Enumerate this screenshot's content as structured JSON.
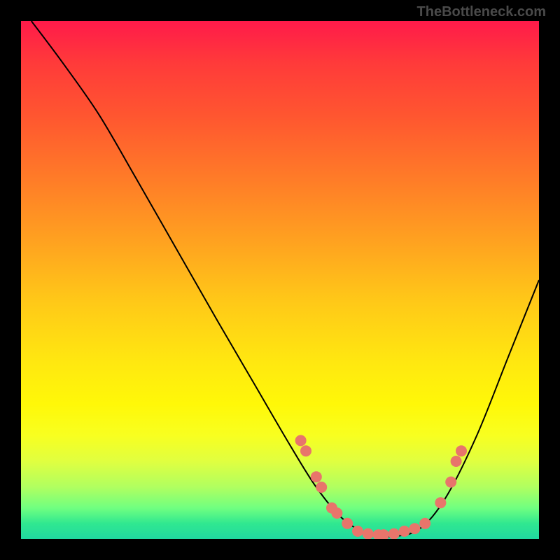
{
  "watermark": "TheBottleneck.com",
  "chart_data": {
    "type": "line",
    "title": "",
    "xlabel": "",
    "ylabel": "",
    "xlim": [
      0,
      100
    ],
    "ylim": [
      0,
      100
    ],
    "curve_points": [
      {
        "x": 2,
        "y": 100
      },
      {
        "x": 8,
        "y": 92
      },
      {
        "x": 15,
        "y": 82
      },
      {
        "x": 22,
        "y": 70
      },
      {
        "x": 30,
        "y": 56
      },
      {
        "x": 38,
        "y": 42
      },
      {
        "x": 45,
        "y": 30
      },
      {
        "x": 52,
        "y": 18
      },
      {
        "x": 57,
        "y": 10
      },
      {
        "x": 62,
        "y": 4
      },
      {
        "x": 67,
        "y": 1
      },
      {
        "x": 72,
        "y": 0.5
      },
      {
        "x": 77,
        "y": 2
      },
      {
        "x": 82,
        "y": 8
      },
      {
        "x": 88,
        "y": 20
      },
      {
        "x": 94,
        "y": 35
      },
      {
        "x": 100,
        "y": 50
      }
    ],
    "scatter_points": [
      {
        "x": 54,
        "y": 19
      },
      {
        "x": 55,
        "y": 17
      },
      {
        "x": 57,
        "y": 12
      },
      {
        "x": 58,
        "y": 10
      },
      {
        "x": 60,
        "y": 6
      },
      {
        "x": 61,
        "y": 5
      },
      {
        "x": 63,
        "y": 3
      },
      {
        "x": 65,
        "y": 1.5
      },
      {
        "x": 67,
        "y": 1
      },
      {
        "x": 69,
        "y": 0.8
      },
      {
        "x": 70,
        "y": 0.8
      },
      {
        "x": 72,
        "y": 1
      },
      {
        "x": 74,
        "y": 1.5
      },
      {
        "x": 76,
        "y": 2
      },
      {
        "x": 78,
        "y": 3
      },
      {
        "x": 81,
        "y": 7
      },
      {
        "x": 83,
        "y": 11
      },
      {
        "x": 84,
        "y": 15
      },
      {
        "x": 85,
        "y": 17
      }
    ],
    "background_gradient": {
      "top": "#ff1a4a",
      "middle": "#ffe810",
      "bottom": "#20d8a0"
    }
  }
}
